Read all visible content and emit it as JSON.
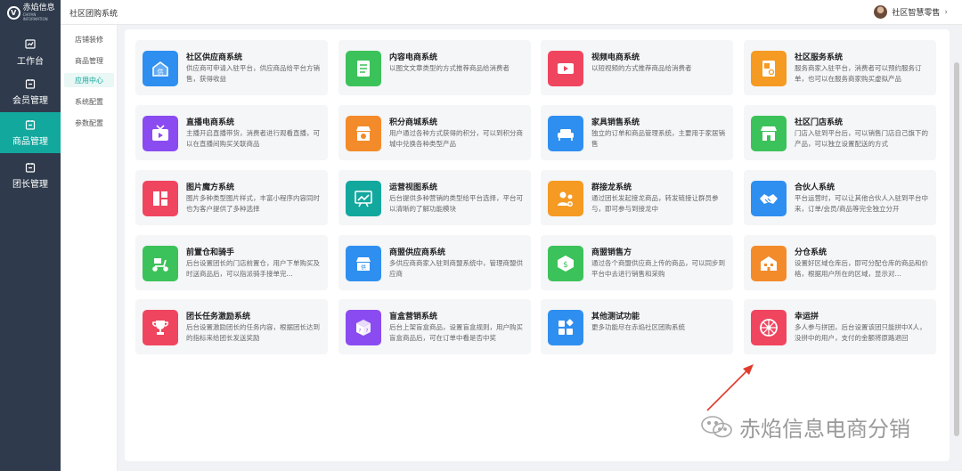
{
  "logo": {
    "text": "赤焰信息",
    "sub": "CHIYAN INFORMATION"
  },
  "nav": [
    {
      "label": "工作台",
      "icon": "dashboard-icon"
    },
    {
      "label": "会员管理",
      "icon": "member-icon"
    },
    {
      "label": "商品管理",
      "icon": "goods-icon",
      "active": true
    },
    {
      "label": "团长管理",
      "icon": "leader-icon"
    }
  ],
  "topbar": {
    "title": "社区团购系统",
    "user": "社区智慧零售",
    "chevron": "›"
  },
  "submenu": [
    {
      "label": "店铺装修"
    },
    {
      "label": "商品管理"
    },
    {
      "label": "应用中心",
      "active": true
    },
    {
      "label": "系统配置"
    },
    {
      "label": "参数配置"
    }
  ],
  "apps": [
    {
      "title": "社区供应商系统",
      "desc": "供应商可申请入驻平台，供应商品给平台方销售，获得收益",
      "color": "#2e8ff0",
      "icon": "supplier-icon"
    },
    {
      "title": "内容电商系统",
      "desc": "以图文文章类型的方式推荐商品给消费者",
      "color": "#3cc25a",
      "icon": "document-icon"
    },
    {
      "title": "视频电商系统",
      "desc": "以短视频的方式推荐商品给消费者",
      "color": "#f0455f",
      "icon": "video-icon"
    },
    {
      "title": "社区服务系统",
      "desc": "服务商家入驻平台，消费者可以预约服务订单，也可以在服务商家购买虚拟产品",
      "color": "#f59a23",
      "icon": "service-icon"
    },
    {
      "title": "直播电商系统",
      "desc": "主播开启直播带货，消费者进行观看直播，可以在直播间购买关联商品",
      "color": "#8a4cf0",
      "icon": "tv-icon"
    },
    {
      "title": "积分商城系统",
      "desc": "用户通过各种方式获得的积分，可以到积分商城中兑换各种类型产品",
      "color": "#f38b2a",
      "icon": "points-store-icon"
    },
    {
      "title": "家具销售系统",
      "desc": "独立的订单和商品管理系统，主要用于家居销售",
      "color": "#2e8ff0",
      "icon": "sofa-icon"
    },
    {
      "title": "社区门店系统",
      "desc": "门店入驻到平台后，可以销售门店自己旗下的产品，可以独立设置配送的方式",
      "color": "#3cc25a",
      "icon": "store-icon"
    },
    {
      "title": "图片魔方系统",
      "desc": "图片多种类型图片样式，丰富小程序内容同时也为客户提供了多种选择",
      "color": "#f0455f",
      "icon": "image-cube-icon"
    },
    {
      "title": "运营视图系统",
      "desc": "后台提供多种营销的类型给平台选择，平台可以清晰的了解功能模块",
      "color": "#13a89e",
      "icon": "chart-board-icon"
    },
    {
      "title": "群接龙系统",
      "desc": "通过团长发起接龙商品，转发链接让群员参与，即可参与到接龙中",
      "color": "#f59a23",
      "icon": "group-icon"
    },
    {
      "title": "合伙人系统",
      "desc": "平台运营时，可以让其他合伙人入驻到平台中来，订单/会员/商品等完全独立分开",
      "color": "#2e8ff0",
      "icon": "handshake-icon"
    },
    {
      "title": "前置仓和骑手",
      "desc": "后台设置团长的门店前置仓，用户下单购买及时送商品后，可以指派骑手接单完...",
      "color": "#3cc25a",
      "icon": "scooter-icon"
    },
    {
      "title": "商盟供应商系统",
      "desc": "多供应商商家入驻到商盟系统中，管理商盟供应商",
      "color": "#2e8ff0",
      "icon": "alliance-supplier-icon"
    },
    {
      "title": "商盟销售方",
      "desc": "通过各个商盟供应商上传的商品，可以同步到平台中去进行销售和采购",
      "color": "#3cc25a",
      "icon": "alliance-sales-icon"
    },
    {
      "title": "分仓系统",
      "desc": "设置好区域仓库后，即可分配仓库的商品和价格，根据用户所在的区域，显示对...",
      "color": "#f38b2a",
      "icon": "warehouse-icon"
    },
    {
      "title": "团长任务激励系统",
      "desc": "后台设置激励团长的任务内容，根据团长达到的指标来给团长发送奖励",
      "color": "#f0455f",
      "icon": "trophy-icon"
    },
    {
      "title": "盲盒营销系统",
      "desc": "后台上架盲盒商品，设置盲盒规则，用户购买盲盒商品后，可在订单中看是否中奖",
      "color": "#8a4cf0",
      "icon": "blind-box-icon"
    },
    {
      "title": "其他测试功能",
      "desc": "更多功能尽在赤焰社区团购系统",
      "color": "#2e8ff0",
      "icon": "apps-icon"
    },
    {
      "title": "幸运拼",
      "desc": "多人参与拼团，后台设置该团只能拼中X人，没拼中的用户，支付的金额将原路退回",
      "color": "#f0455f",
      "icon": "lucky-wheel-icon"
    }
  ],
  "watermark": {
    "text": "赤焰信息电商分销",
    "icon": "wechat-icon"
  }
}
